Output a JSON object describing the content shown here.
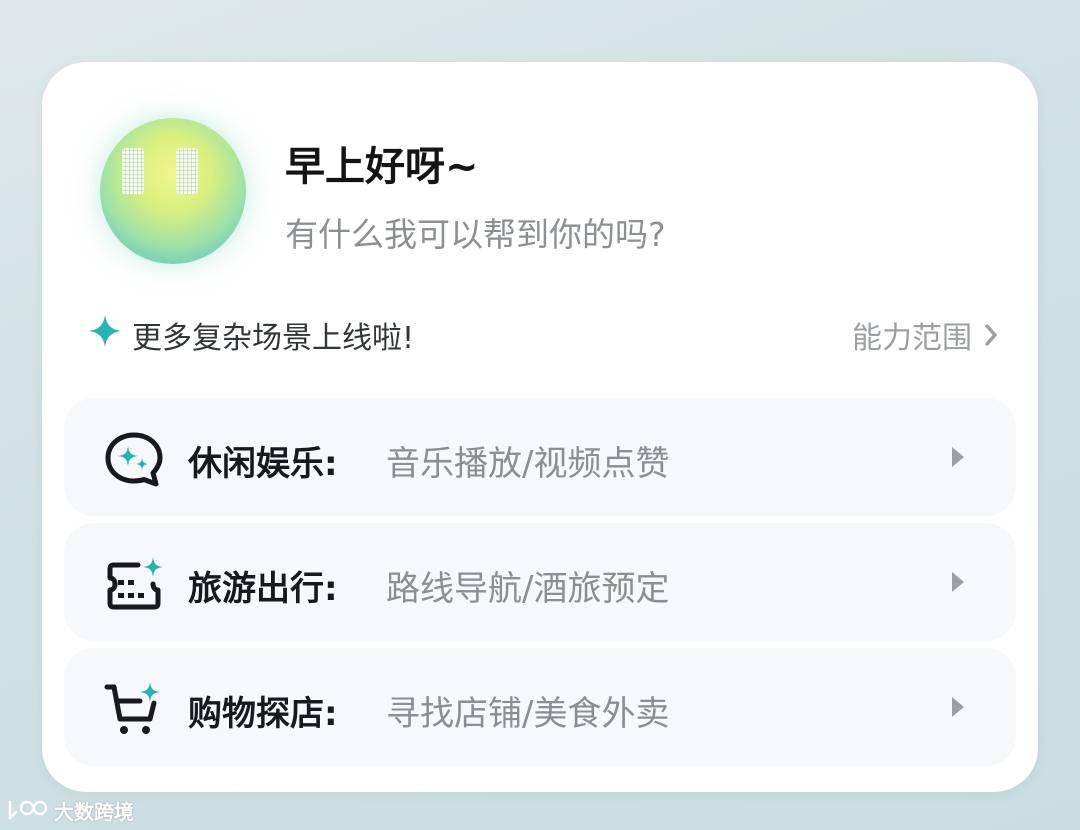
{
  "header": {
    "greeting": "早上好呀~",
    "subtitle": "有什么我可以帮到你的吗?"
  },
  "notice": {
    "icon": "sparkle-icon",
    "text": "更多复杂场景上线啦!",
    "link_label": "能力范围",
    "accent_color": "#25b4b4"
  },
  "features": [
    {
      "icon": "chat-sparkle-icon",
      "category": "休闲娱乐:",
      "description": "音乐播放/视频点赞"
    },
    {
      "icon": "ticket-sparkle-icon",
      "category": "旅游出行:",
      "description": "路线导航/酒旅预定"
    },
    {
      "icon": "cart-sparkle-icon",
      "category": "购物探店:",
      "description": "寻找店铺/美食外卖"
    }
  ],
  "watermark": {
    "text": "大数跨境"
  }
}
